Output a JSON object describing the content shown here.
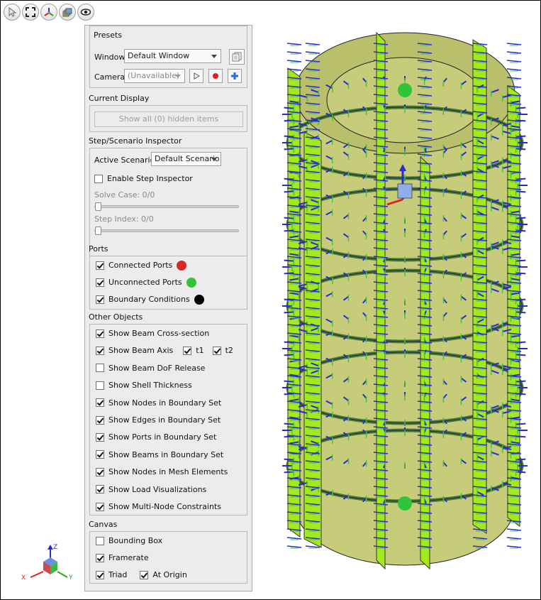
{
  "toolbar": {
    "icons": [
      "cursor-icon",
      "fit-view-icon",
      "axes-icon",
      "layers-icon",
      "eye-icon"
    ]
  },
  "presets": {
    "title": "Presets",
    "window_label": "Window",
    "window_value": "Default Window",
    "camera_label": "Camera",
    "camera_value": "(Unavailable)"
  },
  "current_display": {
    "title": "Current Display",
    "show_hidden_button": "Show all (0) hidden items"
  },
  "step": {
    "title": "Step/Scenario Inspector",
    "active_scenario_label": "Active Scenario:",
    "active_scenario_value": "Default Scenario",
    "enable_label": "Enable Step Inspector",
    "enable_checked": false,
    "solve_case_label": "Solve Case: 0/0",
    "step_index_label": "Step Index: 0/0",
    "solve_case_fraction": 0,
    "step_index_fraction": 0
  },
  "ports": {
    "title": "Ports",
    "items": [
      {
        "label": "Connected Ports",
        "checked": true,
        "color": "#d42a2a"
      },
      {
        "label": "Unconnected Ports",
        "checked": true,
        "color": "#2fc43a"
      },
      {
        "label": "Boundary Conditions",
        "checked": true,
        "color": "#000000"
      }
    ]
  },
  "other": {
    "title": "Other Objects",
    "items": [
      {
        "label": "Show Beam Cross-section",
        "checked": true
      },
      {
        "label": "Show Beam Axis",
        "checked": true
      },
      {
        "label": "Show Beam DoF Release",
        "checked": false
      },
      {
        "label": "Show Shell Thickness",
        "checked": false
      },
      {
        "label": "Show Nodes in Boundary Set",
        "checked": true
      },
      {
        "label": "Show Edges in Boundary Set",
        "checked": true
      },
      {
        "label": "Show Ports in Boundary Set",
        "checked": true
      },
      {
        "label": "Show Beams in Boundary Set",
        "checked": true
      },
      {
        "label": "Show Nodes in Mesh Elements",
        "checked": true
      },
      {
        "label": "Show Load Visualizations",
        "checked": true
      },
      {
        "label": "Show Multi-Node Constraints",
        "checked": true
      }
    ],
    "t1_label": "t1",
    "t2_label": "t2"
  },
  "canvas": {
    "title": "Canvas",
    "bounding_box": "Bounding Box",
    "framerate": "Framerate",
    "triad": "Triad",
    "at_origin": "At Origin"
  },
  "triad": {
    "x": "X",
    "y": "Y",
    "z": "Z"
  },
  "colors": {
    "cylinder_fill": "#c6cc7a",
    "fin_fill": "#a4e81e",
    "load_arrow": "#2a2ad0",
    "node_marker": "#2fc43a"
  }
}
